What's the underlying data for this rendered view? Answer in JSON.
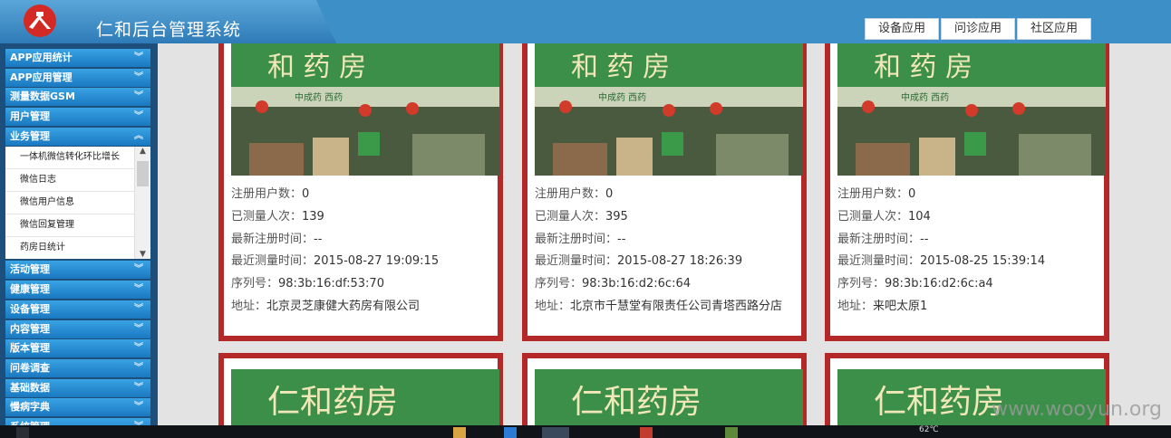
{
  "header": {
    "title": "仁和后台管理系统",
    "buttons": [
      "设备应用",
      "问诊应用",
      "社区应用"
    ]
  },
  "sidebar": {
    "menus_top": [
      "APP应用统计",
      "APP应用管理",
      "测量数据GSM",
      "用户管理",
      "业务管理"
    ],
    "sub_items": [
      "一体机微信转化环比增长",
      "微信日志",
      "微信用户信息",
      "微信回复管理",
      "药房日统计"
    ],
    "menus_bottom": [
      "活动管理",
      "健康管理",
      "设备管理",
      "内容管理",
      "版本管理",
      "问卷调查",
      "基础数据",
      "慢病字典",
      "系统管理"
    ]
  },
  "cards": [
    {
      "registered_label": "注册用户数：",
      "registered": "0",
      "measured_label": "已测量人次：",
      "measured": "139",
      "last_reg_label": "最新注册时间：",
      "last_reg": "--",
      "last_measure_label": "最近测量时间：",
      "last_measure": "2015-08-27 19:09:15",
      "serial_label": "序列号：",
      "serial": "98:3b:16:df:53:70",
      "address_label": "地址：",
      "address": "北京灵芝康健大药房有限公司"
    },
    {
      "registered_label": "注册用户数：",
      "registered": "0",
      "measured_label": "已测量人次：",
      "measured": "395",
      "last_reg_label": "最新注册时间：",
      "last_reg": "--",
      "last_measure_label": "最近测量时间：",
      "last_measure": "2015-08-27 18:26:39",
      "serial_label": "序列号：",
      "serial": "98:3b:16:d2:6c:64",
      "address_label": "地址：",
      "address": "北京市千慧堂有限责任公司青塔西路分店"
    },
    {
      "registered_label": "注册用户数：",
      "registered": "0",
      "measured_label": "已测量人次：",
      "measured": "104",
      "last_reg_label": "最新注册时间：",
      "last_reg": "--",
      "last_measure_label": "最近测量时间：",
      "last_measure": "2015-08-25 15:39:14",
      "serial_label": "序列号：",
      "serial": "98:3b:16:d2:6c:a4",
      "address_label": "地址：",
      "address": "来吧太原1"
    }
  ],
  "store_sign_text": "仁和药房",
  "taskbar": {
    "temperature": "62℃"
  },
  "watermark": "www.wooyun.org",
  "colors": {
    "header_blue": "#3d8fc8",
    "sidebar_navy": "#1d4f7d",
    "card_border": "#b52828",
    "menu_blue": "#1a78c0"
  }
}
